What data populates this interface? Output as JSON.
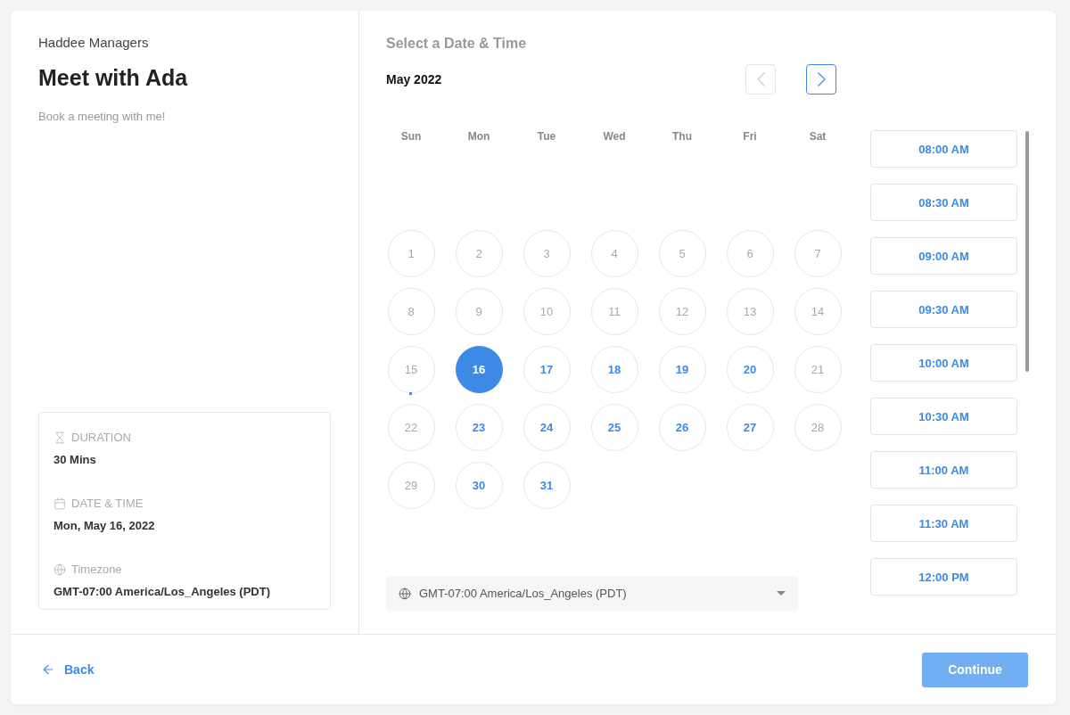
{
  "organizer": "Haddee Managers",
  "title": "Meet with Ada",
  "description": "Book a meeting with me!",
  "details": [
    {
      "kind": "duration",
      "label": "DURATION",
      "value": "30 Mins"
    },
    {
      "kind": "date",
      "label": "DATE & TIME",
      "value": "Mon, May 16, 2022"
    },
    {
      "kind": "timezone",
      "label": "Timezone",
      "value": "GMT-07:00 America/Los_Angeles (PDT)"
    }
  ],
  "heading": "Select a Date & Time",
  "month": "May 2022",
  "nav": [
    {
      "kind": "prev",
      "disabled": true
    },
    {
      "kind": "next",
      "disabled": false
    }
  ],
  "weekdays": [
    "Sun",
    "Mon",
    "Tue",
    "Wed",
    "Thu",
    "Fri",
    "Sat"
  ],
  "days": [
    {
      "label": "1",
      "available": false,
      "selected": false,
      "today": false
    },
    {
      "label": "2",
      "available": false,
      "selected": false,
      "today": false
    },
    {
      "label": "3",
      "available": false,
      "selected": false,
      "today": false
    },
    {
      "label": "4",
      "available": false,
      "selected": false,
      "today": false
    },
    {
      "label": "5",
      "available": false,
      "selected": false,
      "today": false
    },
    {
      "label": "6",
      "available": false,
      "selected": false,
      "today": false
    },
    {
      "label": "7",
      "available": false,
      "selected": false,
      "today": false
    },
    {
      "label": "8",
      "available": false,
      "selected": false,
      "today": false
    },
    {
      "label": "9",
      "available": false,
      "selected": false,
      "today": false
    },
    {
      "label": "10",
      "available": false,
      "selected": false,
      "today": false
    },
    {
      "label": "11",
      "available": false,
      "selected": false,
      "today": false
    },
    {
      "label": "12",
      "available": false,
      "selected": false,
      "today": false
    },
    {
      "label": "13",
      "available": false,
      "selected": false,
      "today": false
    },
    {
      "label": "14",
      "available": false,
      "selected": false,
      "today": false
    },
    {
      "label": "15",
      "available": false,
      "selected": false,
      "today": true
    },
    {
      "label": "16",
      "available": true,
      "selected": true,
      "today": false
    },
    {
      "label": "17",
      "available": true,
      "selected": false,
      "today": false
    },
    {
      "label": "18",
      "available": true,
      "selected": false,
      "today": false
    },
    {
      "label": "19",
      "available": true,
      "selected": false,
      "today": false
    },
    {
      "label": "20",
      "available": true,
      "selected": false,
      "today": false
    },
    {
      "label": "21",
      "available": false,
      "selected": false,
      "today": false
    },
    {
      "label": "22",
      "available": false,
      "selected": false,
      "today": false
    },
    {
      "label": "23",
      "available": true,
      "selected": false,
      "today": false
    },
    {
      "label": "24",
      "available": true,
      "selected": false,
      "today": false
    },
    {
      "label": "25",
      "available": true,
      "selected": false,
      "today": false
    },
    {
      "label": "26",
      "available": true,
      "selected": false,
      "today": false
    },
    {
      "label": "27",
      "available": true,
      "selected": false,
      "today": false
    },
    {
      "label": "28",
      "available": false,
      "selected": false,
      "today": false
    },
    {
      "label": "29",
      "available": false,
      "selected": false,
      "today": false
    },
    {
      "label": "30",
      "available": true,
      "selected": false,
      "today": false
    },
    {
      "label": "31",
      "available": true,
      "selected": false,
      "today": false
    }
  ],
  "timezone_select": {
    "value": "GMT-07:00 America/Los_Angeles (PDT)"
  },
  "times": [
    {
      "label": "08:00 AM",
      "selected": false
    },
    {
      "label": "08:30 AM",
      "selected": false
    },
    {
      "label": "09:00 AM",
      "selected": false
    },
    {
      "label": "09:30 AM",
      "selected": false
    },
    {
      "label": "10:00 AM",
      "selected": false
    },
    {
      "label": "10:30 AM",
      "selected": false
    },
    {
      "label": "11:00 AM",
      "selected": false
    },
    {
      "label": "11:30 AM",
      "selected": false
    },
    {
      "label": "12:00 PM",
      "selected": false
    }
  ],
  "back": "Back",
  "continue": {
    "label": "Continue",
    "disabled": true
  }
}
